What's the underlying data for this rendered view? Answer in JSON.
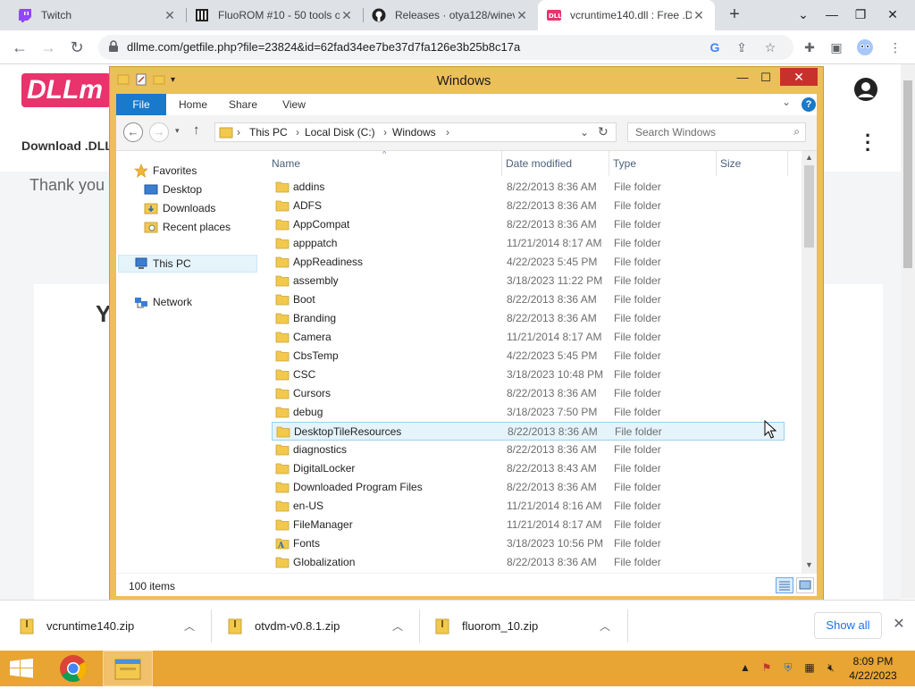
{
  "browser": {
    "tabs": [
      {
        "title": "Twitch",
        "icon": "twitch-icon"
      },
      {
        "title": "FluoROM #10 - 50 tools o",
        "icon": "page-icon"
      },
      {
        "title": "Releases · otya128/winev",
        "icon": "github-icon"
      },
      {
        "title": "vcruntime140.dll : Free .D",
        "icon": "dllme-icon",
        "active": true
      }
    ],
    "new_tab": "+",
    "url": "dllme.com/getfile.php?file=23824&id=62fad34ee7be37d7fa126e3b25b8c17a"
  },
  "website": {
    "logo_text": "DLLm",
    "nav_text": "Download .DLL",
    "thank_text": "Thank you",
    "card_heading": "Y"
  },
  "explorer": {
    "title": "Windows",
    "ribbon_tabs": [
      "File",
      "Home",
      "Share",
      "View"
    ],
    "breadcrumb": [
      "This PC",
      "Local Disk (C:)",
      "Windows"
    ],
    "search_placeholder": "Search Windows",
    "nav": {
      "favorites": "Favorites",
      "desktop": "Desktop",
      "downloads": "Downloads",
      "recent": "Recent places",
      "this_pc": "This PC",
      "network": "Network"
    },
    "columns": [
      "Name",
      "Date modified",
      "Type",
      "Size"
    ],
    "rows": [
      {
        "name": "addins",
        "date": "8/22/2013 8:36 AM",
        "type": "File folder"
      },
      {
        "name": "ADFS",
        "date": "8/22/2013 8:36 AM",
        "type": "File folder"
      },
      {
        "name": "AppCompat",
        "date": "8/22/2013 8:36 AM",
        "type": "File folder"
      },
      {
        "name": "apppatch",
        "date": "11/21/2014 8:17 AM",
        "type": "File folder"
      },
      {
        "name": "AppReadiness",
        "date": "4/22/2023 5:45 PM",
        "type": "File folder"
      },
      {
        "name": "assembly",
        "date": "3/18/2023 11:22 PM",
        "type": "File folder"
      },
      {
        "name": "Boot",
        "date": "8/22/2013 8:36 AM",
        "type": "File folder"
      },
      {
        "name": "Branding",
        "date": "8/22/2013 8:36 AM",
        "type": "File folder"
      },
      {
        "name": "Camera",
        "date": "11/21/2014 8:17 AM",
        "type": "File folder"
      },
      {
        "name": "CbsTemp",
        "date": "4/22/2023 5:45 PM",
        "type": "File folder"
      },
      {
        "name": "CSC",
        "date": "3/18/2023 10:48 PM",
        "type": "File folder"
      },
      {
        "name": "Cursors",
        "date": "8/22/2013 8:36 AM",
        "type": "File folder"
      },
      {
        "name": "debug",
        "date": "3/18/2023 7:50 PM",
        "type": "File folder"
      },
      {
        "name": "DesktopTileResources",
        "date": "8/22/2013 8:36 AM",
        "type": "File folder",
        "selected": true
      },
      {
        "name": "diagnostics",
        "date": "8/22/2013 8:36 AM",
        "type": "File folder"
      },
      {
        "name": "DigitalLocker",
        "date": "8/22/2013 8:43 AM",
        "type": "File folder"
      },
      {
        "name": "Downloaded Program Files",
        "date": "8/22/2013 8:36 AM",
        "type": "File folder"
      },
      {
        "name": "en-US",
        "date": "11/21/2014 8:16 AM",
        "type": "File folder"
      },
      {
        "name": "FileManager",
        "date": "11/21/2014 8:17 AM",
        "type": "File folder"
      },
      {
        "name": "Fonts",
        "date": "3/18/2023 10:56 PM",
        "type": "File folder",
        "icon": "fonts-folder-icon"
      },
      {
        "name": "Globalization",
        "date": "8/22/2013 8:36 AM",
        "type": "File folder"
      }
    ],
    "status": "100 items"
  },
  "downloads": [
    {
      "name": "vcruntime140.zip"
    },
    {
      "name": "otvdm-v0.8.1.zip"
    },
    {
      "name": "fluorom_10.zip"
    }
  ],
  "downloads_show_all": "Show all",
  "taskbar": {
    "time": "8:09 PM",
    "date": "4/22/2023"
  },
  "colors": {
    "explorer_frame": "#ebbf5a",
    "taskbar": "#e8a533",
    "file_tab": "#1979ca",
    "close_button": "#c7312b",
    "selection": "#e5f3fb",
    "brand_pink": "#e8336d"
  }
}
